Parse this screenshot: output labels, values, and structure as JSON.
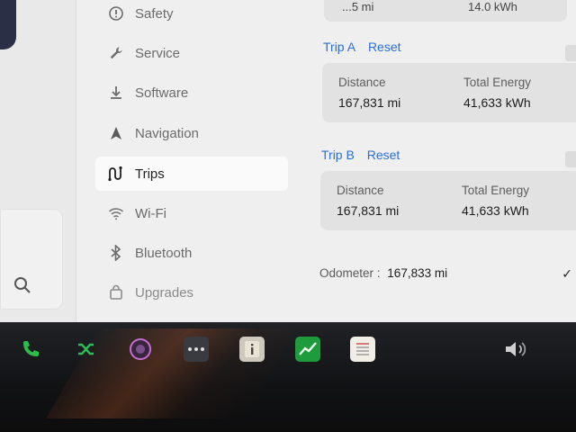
{
  "menu": {
    "items": [
      {
        "label": "Safety",
        "icon": "alert-circle-icon"
      },
      {
        "label": "Service",
        "icon": "wrench-icon"
      },
      {
        "label": "Software",
        "icon": "download-icon"
      },
      {
        "label": "Navigation",
        "icon": "navigation-arrow-icon"
      },
      {
        "label": "Trips",
        "icon": "trips-icon",
        "active": true
      },
      {
        "label": "Wi-Fi",
        "icon": "wifi-icon"
      },
      {
        "label": "Bluetooth",
        "icon": "bluetooth-icon"
      },
      {
        "label": "Upgrades",
        "icon": "bag-icon"
      }
    ]
  },
  "top_card": {
    "left": "...5 mi",
    "right": "14.0 kWh"
  },
  "trip_a": {
    "title": "Trip A",
    "reset": "Reset",
    "distance_label": "Distance",
    "distance_value": "167,831 mi",
    "energy_label": "Total Energy",
    "energy_value": "41,633 kWh"
  },
  "trip_b": {
    "title": "Trip B",
    "reset": "Reset",
    "distance_label": "Distance",
    "distance_value": "167,831 mi",
    "energy_label": "Total Energy",
    "energy_value": "41,633 kWh"
  },
  "odometer": {
    "label": "Odometer :",
    "value": "167,833 mi"
  },
  "taskbar": {
    "icons": [
      "phone-icon",
      "shuffle-icon",
      "camera-icon",
      "more-icon",
      "info-icon",
      "chart-icon",
      "notes-icon",
      "volume-icon"
    ]
  },
  "colors": {
    "accent": "#2a6fd6",
    "phone": "#2bbf4a",
    "chart": "#1e9b3c"
  }
}
